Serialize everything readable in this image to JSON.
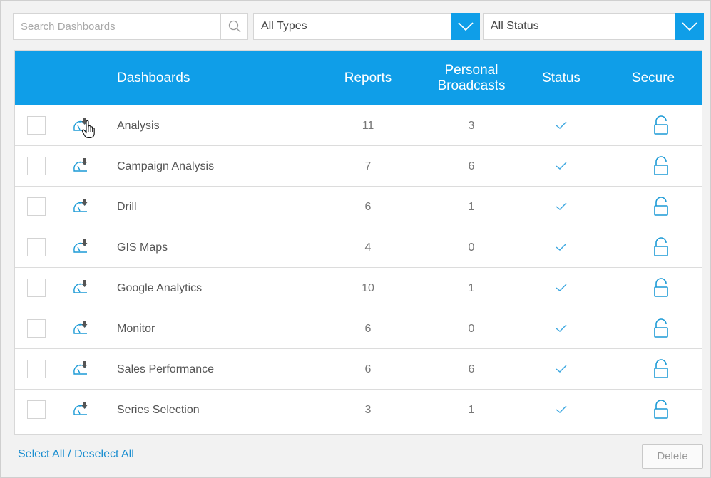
{
  "filters": {
    "search_placeholder": "Search Dashboards",
    "type_selected": "All Types",
    "status_selected": "All Status"
  },
  "table": {
    "headers": {
      "dashboards": "Dashboards",
      "reports": "Reports",
      "personal_line1": "Personal",
      "personal_line2": "Broadcasts",
      "status": "Status",
      "secure": "Secure"
    },
    "rows": [
      {
        "name": "Analysis",
        "reports": "11",
        "personal_broadcasts": "3",
        "status": "active",
        "secure": "unlocked"
      },
      {
        "name": "Campaign Analysis",
        "reports": "7",
        "personal_broadcasts": "6",
        "status": "active",
        "secure": "unlocked"
      },
      {
        "name": "Drill",
        "reports": "6",
        "personal_broadcasts": "1",
        "status": "active",
        "secure": "unlocked"
      },
      {
        "name": "GIS Maps",
        "reports": "4",
        "personal_broadcasts": "0",
        "status": "active",
        "secure": "unlocked"
      },
      {
        "name": "Google Analytics",
        "reports": "10",
        "personal_broadcasts": "1",
        "status": "active",
        "secure": "unlocked"
      },
      {
        "name": "Monitor",
        "reports": "6",
        "personal_broadcasts": "0",
        "status": "active",
        "secure": "unlocked"
      },
      {
        "name": "Sales Performance",
        "reports": "6",
        "personal_broadcasts": "6",
        "status": "active",
        "secure": "unlocked"
      },
      {
        "name": "Series Selection",
        "reports": "3",
        "personal_broadcasts": "1",
        "status": "active",
        "secure": "unlocked"
      }
    ]
  },
  "footer": {
    "select_all": "Select All",
    "separator": " / ",
    "deselect_all": "Deselect All",
    "delete_label": "Delete"
  },
  "icons": {
    "search": "magnifier-icon",
    "dropdown": "chevron-down-icon",
    "dashboard": "dashboard-import-icon",
    "status": "checkmark-icon",
    "secure": "unlocked-padlock-icon",
    "cursor": "hand-pointer-icon"
  },
  "colors": {
    "accent": "#0f9ee8",
    "link": "#1b8ed0",
    "background": "#f2f2f2"
  }
}
